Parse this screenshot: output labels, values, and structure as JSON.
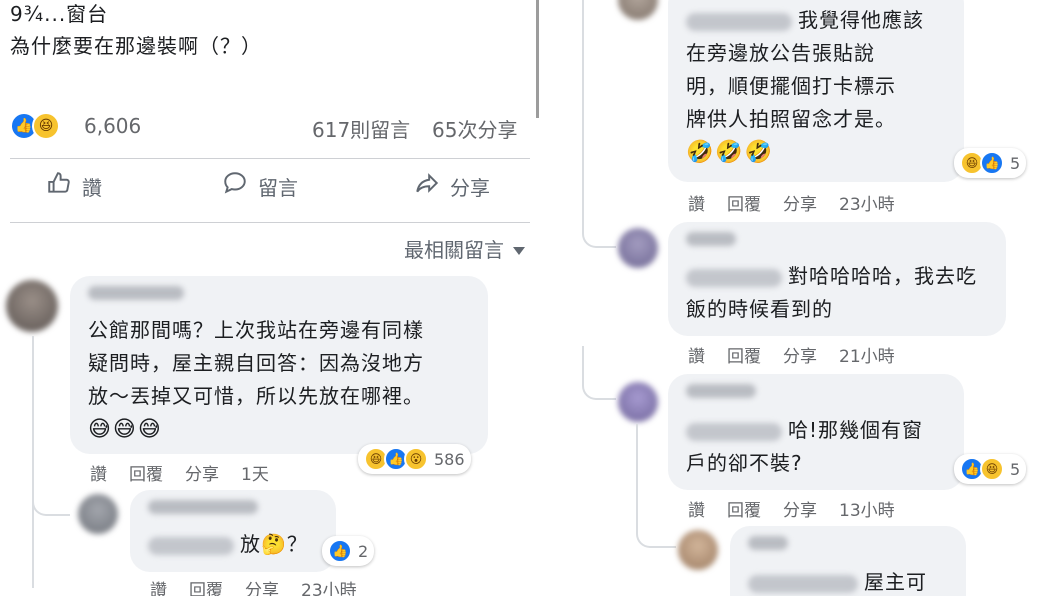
{
  "post": {
    "line1": "9¾...窗台",
    "line2": "為什麼要在那邊裝啊（？）",
    "reaction_count": "6,606",
    "comments_count": "617則留言",
    "shares_count": "65次分享"
  },
  "actions": {
    "like": "讚",
    "comment": "留言",
    "share": "分享"
  },
  "sort_label": "最相關留言",
  "meta_labels": {
    "like": "讚",
    "reply": "回覆",
    "share": "分享"
  },
  "left_comments": [
    {
      "lines": [
        "公館那間嗎？上次我站在旁邊有同樣",
        "疑問時，屋主親自回答：因為沒地方",
        "放～丟掉又可惜，所以先放在哪裡。"
      ],
      "emoji": "😅😅😅",
      "reaction_count": "586",
      "time": "1天"
    },
    {
      "lines": [
        "放🤔？"
      ],
      "reaction_count": "2",
      "time": "23小時"
    }
  ],
  "right_comments": [
    {
      "lines": [
        "我覺得他應該",
        "在旁邊放公告張貼說",
        "明，順便擺個打卡標示",
        "牌供人拍照留念才是。"
      ],
      "emoji": "🤣🤣🤣",
      "reaction_count": "5",
      "time": "23小時"
    },
    {
      "lines": [
        "對哈哈哈哈，我去吃",
        "飯的時候看到的"
      ],
      "time": "21小時"
    },
    {
      "lines": [
        "哈!那幾個有窗",
        "戶的卻不裝?"
      ],
      "reaction_count": "5",
      "time": "13小時"
    },
    {
      "lines": [
        "屋主可"
      ]
    }
  ],
  "colors": {
    "like": "#1877f2",
    "haha": "#f7c32e",
    "bubble": "#f0f2f5",
    "meta": "#65676b"
  }
}
